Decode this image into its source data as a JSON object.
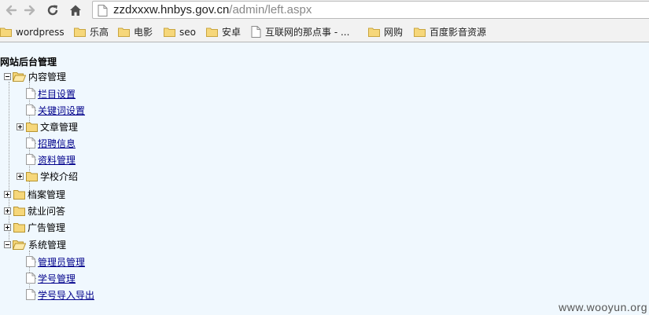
{
  "browser": {
    "url_host": "zzdxxxw.hnbys.gov.cn",
    "url_path": "/admin/left.aspx",
    "bookmarks": [
      "wordpress",
      "乐高",
      "电影",
      "seo",
      "安卓",
      "互联网的那点事 - ...",
      "网购",
      "百度影音资源"
    ]
  },
  "page": {
    "title": "网站后台管理",
    "tree": {
      "content": {
        "label": "内容管理",
        "children": {
          "column_settings": "栏目设置",
          "keyword_settings": "关键词设置",
          "article_management": "文章管理",
          "recruitment_info": "招聘信息",
          "data_management": "资料管理",
          "school_intro": "学校介绍"
        }
      },
      "archives": {
        "label": "档案管理"
      },
      "employment_qa": {
        "label": "就业问答"
      },
      "ads": {
        "label": "广告管理"
      },
      "system": {
        "label": "系统管理",
        "children": {
          "admin_management": "管理员管理",
          "student_id_management": "学号管理",
          "student_id_import_export": "学号导入导出"
        }
      }
    }
  },
  "watermark": "www.wooyun.org",
  "colors": {
    "page_bg": "#f0f8fe",
    "chrome_bg": "#f2f2f2",
    "link": "#00008b",
    "folder": "#f6d77a"
  },
  "icons": {
    "back": "back-arrow-icon",
    "forward": "forward-arrow-icon",
    "reload": "reload-icon",
    "home": "home-icon",
    "page": "page-icon",
    "bookmark_folder": "folder-icon",
    "tree_expand": "plus-box-icon",
    "tree_collapse": "minus-box-icon",
    "folder_open": "folder-open-icon",
    "folder_closed": "folder-closed-icon",
    "document": "document-icon"
  }
}
